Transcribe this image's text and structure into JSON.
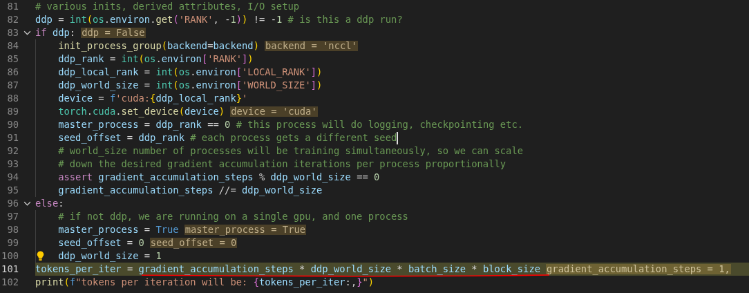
{
  "editor": {
    "lines": [
      {
        "number": "81",
        "selected": false,
        "cursor": false,
        "code": [
          {
            "kind": "c",
            "text": "# various inits, derived attributes, I/O setup"
          }
        ]
      },
      {
        "number": "82",
        "selected": false,
        "cursor": false,
        "code": [
          {
            "kind": "v",
            "text": "ddp"
          },
          {
            "kind": "o",
            "text": " = "
          },
          {
            "kind": "t",
            "text": "int"
          },
          {
            "kind": "b1",
            "text": "("
          },
          {
            "kind": "t",
            "text": "os"
          },
          {
            "kind": "o",
            "text": "."
          },
          {
            "kind": "v",
            "text": "environ"
          },
          {
            "kind": "o",
            "text": "."
          },
          {
            "kind": "f",
            "text": "get"
          },
          {
            "kind": "b2",
            "text": "("
          },
          {
            "kind": "s",
            "text": "'RANK'"
          },
          {
            "kind": "o",
            "text": ", -"
          },
          {
            "kind": "n",
            "text": "1"
          },
          {
            "kind": "b2",
            "text": ")"
          },
          {
            "kind": "b1",
            "text": ")"
          },
          {
            "kind": "o",
            "text": " != -"
          },
          {
            "kind": "n",
            "text": "1"
          },
          {
            "kind": "c",
            "text": " # is this a ddp run?"
          }
        ]
      },
      {
        "number": "83",
        "selected": false,
        "cursor": false,
        "expanded": true,
        "code": [
          {
            "kind": "k",
            "text": "if"
          },
          {
            "kind": "v",
            "text": " ddp"
          },
          {
            "kind": "o",
            "text": ":"
          }
        ],
        "hint": "ddp = False",
        "children": [
          {
            "number": "84",
            "selected": false,
            "cursor": false,
            "code": [
              {
                "kind": "f",
                "text": "init_process_group"
              },
              {
                "kind": "b1",
                "text": "("
              },
              {
                "kind": "v",
                "text": "backend"
              },
              {
                "kind": "o",
                "text": "="
              },
              {
                "kind": "v",
                "text": "backend"
              },
              {
                "kind": "b1",
                "text": ")"
              }
            ],
            "hint": "backend = 'nccl'"
          },
          {
            "number": "85",
            "selected": false,
            "cursor": false,
            "code": [
              {
                "kind": "v",
                "text": "ddp_rank"
              },
              {
                "kind": "o",
                "text": " = "
              },
              {
                "kind": "t",
                "text": "int"
              },
              {
                "kind": "b1",
                "text": "("
              },
              {
                "kind": "t",
                "text": "os"
              },
              {
                "kind": "o",
                "text": "."
              },
              {
                "kind": "v",
                "text": "environ"
              },
              {
                "kind": "b2",
                "text": "["
              },
              {
                "kind": "s",
                "text": "'RANK'"
              },
              {
                "kind": "b2",
                "text": "]"
              },
              {
                "kind": "b1",
                "text": ")"
              }
            ]
          },
          {
            "number": "86",
            "selected": false,
            "cursor": false,
            "code": [
              {
                "kind": "v",
                "text": "ddp_local_rank"
              },
              {
                "kind": "o",
                "text": " = "
              },
              {
                "kind": "t",
                "text": "int"
              },
              {
                "kind": "b1",
                "text": "("
              },
              {
                "kind": "t",
                "text": "os"
              },
              {
                "kind": "o",
                "text": "."
              },
              {
                "kind": "v",
                "text": "environ"
              },
              {
                "kind": "b2",
                "text": "["
              },
              {
                "kind": "s",
                "text": "'LOCAL_RANK'"
              },
              {
                "kind": "b2",
                "text": "]"
              },
              {
                "kind": "b1",
                "text": ")"
              }
            ]
          },
          {
            "number": "87",
            "selected": false,
            "cursor": false,
            "code": [
              {
                "kind": "v",
                "text": "ddp_world_size"
              },
              {
                "kind": "o",
                "text": " = "
              },
              {
                "kind": "t",
                "text": "int"
              },
              {
                "kind": "b1",
                "text": "("
              },
              {
                "kind": "t",
                "text": "os"
              },
              {
                "kind": "o",
                "text": "."
              },
              {
                "kind": "v",
                "text": "environ"
              },
              {
                "kind": "b2",
                "text": "["
              },
              {
                "kind": "s",
                "text": "'WORLD_SIZE'"
              },
              {
                "kind": "b2",
                "text": "]"
              },
              {
                "kind": "b1",
                "text": ")"
              }
            ]
          },
          {
            "number": "88",
            "selected": false,
            "cursor": false,
            "code": [
              {
                "kind": "v",
                "text": "device"
              },
              {
                "kind": "o",
                "text": " = "
              },
              {
                "kind": "cst",
                "text": "f"
              },
              {
                "kind": "s",
                "text": "'cuda:"
              },
              {
                "kind": "b1",
                "text": "{"
              },
              {
                "kind": "v",
                "text": "ddp_local_rank"
              },
              {
                "kind": "b1",
                "text": "}"
              },
              {
                "kind": "s",
                "text": "'"
              }
            ]
          },
          {
            "number": "89",
            "selected": false,
            "cursor": false,
            "code": [
              {
                "kind": "t",
                "text": "torch"
              },
              {
                "kind": "o",
                "text": "."
              },
              {
                "kind": "t",
                "text": "cuda"
              },
              {
                "kind": "o",
                "text": "."
              },
              {
                "kind": "f",
                "text": "set_device"
              },
              {
                "kind": "b1",
                "text": "("
              },
              {
                "kind": "v",
                "text": "device"
              },
              {
                "kind": "b1",
                "text": ")"
              }
            ],
            "hint": "device = 'cuda'"
          },
          {
            "number": "90",
            "selected": false,
            "cursor": false,
            "code": [
              {
                "kind": "v",
                "text": "master_process"
              },
              {
                "kind": "o",
                "text": " = "
              },
              {
                "kind": "v",
                "text": "ddp_rank"
              },
              {
                "kind": "o",
                "text": " == "
              },
              {
                "kind": "n",
                "text": "0"
              },
              {
                "kind": "c",
                "text": " # this process will do logging, checkpointing etc."
              }
            ]
          },
          {
            "number": "91",
            "selected": false,
            "cursor": true,
            "code": [
              {
                "kind": "v",
                "text": "seed_offset"
              },
              {
                "kind": "o",
                "text": " = "
              },
              {
                "kind": "v",
                "text": "ddp_rank"
              },
              {
                "kind": "c",
                "text": " # each process gets a different seed"
              }
            ]
          },
          {
            "number": "92",
            "selected": false,
            "cursor": false,
            "code": [
              {
                "kind": "c",
                "text": "# world_size number of processes will be training simultaneously, so we can scale"
              }
            ]
          },
          {
            "number": "93",
            "selected": false,
            "cursor": false,
            "code": [
              {
                "kind": "c",
                "text": "# down the desired gradient accumulation iterations per process proportionally"
              }
            ]
          },
          {
            "number": "94",
            "selected": false,
            "cursor": false,
            "code": [
              {
                "kind": "k",
                "text": "assert"
              },
              {
                "kind": "v",
                "text": " gradient_accumulation_steps"
              },
              {
                "kind": "o",
                "text": " % "
              },
              {
                "kind": "v",
                "text": "ddp_world_size"
              },
              {
                "kind": "o",
                "text": " == "
              },
              {
                "kind": "n",
                "text": "0"
              }
            ]
          },
          {
            "number": "95",
            "selected": false,
            "cursor": false,
            "code": [
              {
                "kind": "v",
                "text": "gradient_accumulation_steps"
              },
              {
                "kind": "o",
                "text": " //= "
              },
              {
                "kind": "v",
                "text": "ddp_world_size"
              }
            ]
          }
        ]
      },
      {
        "number": "96",
        "selected": false,
        "cursor": false,
        "expanded": true,
        "code": [
          {
            "kind": "k",
            "text": "else"
          },
          {
            "kind": "o",
            "text": ":"
          }
        ],
        "children": [
          {
            "number": "97",
            "selected": false,
            "cursor": false,
            "code": [
              {
                "kind": "c",
                "text": "# if not ddp, we are running on a single gpu, and one process"
              }
            ]
          },
          {
            "number": "98",
            "selected": false,
            "cursor": false,
            "code": [
              {
                "kind": "v",
                "text": "master_process"
              },
              {
                "kind": "o",
                "text": " = "
              },
              {
                "kind": "cst",
                "text": "True"
              }
            ],
            "hint": "master_process = True"
          },
          {
            "number": "99",
            "selected": false,
            "cursor": false,
            "code": [
              {
                "kind": "v",
                "text": "seed_offset"
              },
              {
                "kind": "o",
                "text": " = "
              },
              {
                "kind": "n",
                "text": "0"
              }
            ],
            "hint": "seed_offset = 0"
          },
          {
            "number": "100",
            "selected": false,
            "cursor": false,
            "lightbulb": true,
            "code": [
              {
                "kind": "v",
                "text": "ddp_world_size"
              },
              {
                "kind": "o",
                "text": " = "
              },
              {
                "kind": "n",
                "text": "1"
              }
            ]
          }
        ]
      },
      {
        "number": "101",
        "selected": true,
        "cursor": false,
        "code": [
          {
            "kind": "v",
            "text": "tokens_per_iter"
          },
          {
            "kind": "o",
            "text": " = "
          },
          {
            "kind": "v",
            "text": "gradient_accumulation_steps"
          },
          {
            "kind": "o",
            "text": " * "
          },
          {
            "kind": "v",
            "text": "ddp_world_size"
          },
          {
            "kind": "o",
            "text": " * "
          },
          {
            "kind": "v",
            "text": "batch_size"
          },
          {
            "kind": "o",
            "text": " * "
          },
          {
            "kind": "v",
            "text": "block_size"
          }
        ],
        "hint": "gradient_accumulation_steps = 1,"
      },
      {
        "number": "102",
        "selected": false,
        "cursor": false,
        "code": [
          {
            "kind": "f",
            "text": "print"
          },
          {
            "kind": "b1",
            "text": "("
          },
          {
            "kind": "cst",
            "text": "f"
          },
          {
            "kind": "s",
            "text": "\"tokens per iteration will be: "
          },
          {
            "kind": "b2",
            "text": "{"
          },
          {
            "kind": "v",
            "text": "tokens_per_iter"
          },
          {
            "kind": "o",
            "text": ":,"
          },
          {
            "kind": "b2",
            "text": "}"
          },
          {
            "kind": "s",
            "text": "\""
          },
          {
            "kind": "b1",
            "text": ")"
          }
        ]
      }
    ],
    "annotation": {
      "kind": "freehand-underline"
    }
  }
}
